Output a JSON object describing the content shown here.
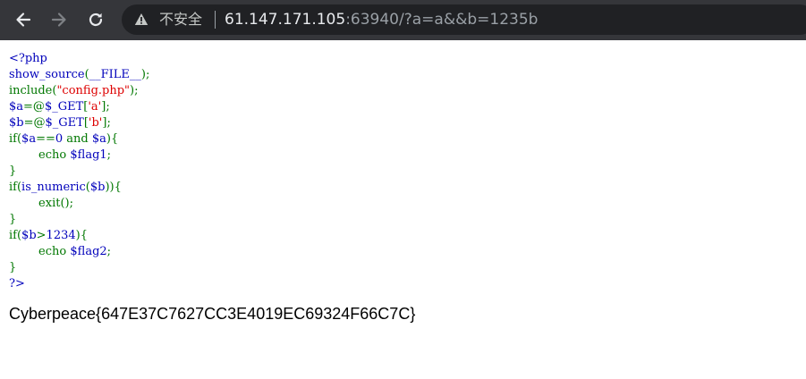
{
  "browser": {
    "security_label": "不安全",
    "url_host": "61.147.171.105",
    "url_rest": ":63940/?a=a&&b=1235b"
  },
  "icons": {
    "back": "arrow-left-icon",
    "forward": "arrow-right-icon",
    "reload": "reload-icon",
    "security": "warning-triangle-icon"
  },
  "colors": {
    "toolbar": "#35363a",
    "omnibox": "#202124",
    "php_default": "#0000bb",
    "php_keyword": "#007700",
    "php_string": "#dd0000"
  },
  "source": {
    "lines": [
      [
        {
          "t": "<?php",
          "c": "def"
        }
      ],
      [
        {
          "t": "show_source",
          "c": "def"
        },
        {
          "t": "(",
          "c": "kw"
        },
        {
          "t": "__FILE__",
          "c": "def"
        },
        {
          "t": ");",
          "c": "kw"
        }
      ],
      [
        {
          "t": "include(",
          "c": "kw"
        },
        {
          "t": "\"config.php\"",
          "c": "str"
        },
        {
          "t": ");",
          "c": "kw"
        }
      ],
      [
        {
          "t": "$a",
          "c": "def"
        },
        {
          "t": "=@",
          "c": "kw"
        },
        {
          "t": "$_GET",
          "c": "def"
        },
        {
          "t": "[",
          "c": "kw"
        },
        {
          "t": "'a'",
          "c": "str"
        },
        {
          "t": "];",
          "c": "kw"
        }
      ],
      [
        {
          "t": "$b",
          "c": "def"
        },
        {
          "t": "=@",
          "c": "kw"
        },
        {
          "t": "$_GET",
          "c": "def"
        },
        {
          "t": "[",
          "c": "kw"
        },
        {
          "t": "'b'",
          "c": "str"
        },
        {
          "t": "];",
          "c": "kw"
        }
      ],
      [
        {
          "t": "if(",
          "c": "kw"
        },
        {
          "t": "$a",
          "c": "def"
        },
        {
          "t": "==",
          "c": "kw"
        },
        {
          "t": "0 ",
          "c": "def"
        },
        {
          "t": "and ",
          "c": "kw"
        },
        {
          "t": "$a",
          "c": "def"
        },
        {
          "t": "){",
          "c": "kw"
        }
      ],
      [
        {
          "t": "        echo ",
          "c": "kw"
        },
        {
          "t": "$flag1",
          "c": "def"
        },
        {
          "t": ";",
          "c": "kw"
        }
      ],
      [
        {
          "t": "}",
          "c": "kw"
        }
      ],
      [
        {
          "t": "if(",
          "c": "kw"
        },
        {
          "t": "is_numeric",
          "c": "def"
        },
        {
          "t": "(",
          "c": "kw"
        },
        {
          "t": "$b",
          "c": "def"
        },
        {
          "t": ")){",
          "c": "kw"
        }
      ],
      [
        {
          "t": "        exit",
          "c": "kw"
        },
        {
          "t": "();",
          "c": "kw"
        }
      ],
      [
        {
          "t": "}",
          "c": "kw"
        }
      ],
      [
        {
          "t": "if(",
          "c": "kw"
        },
        {
          "t": "$b",
          "c": "def"
        },
        {
          "t": ">",
          "c": "kw"
        },
        {
          "t": "1234",
          "c": "def"
        },
        {
          "t": "){",
          "c": "kw"
        }
      ],
      [
        {
          "t": "        echo ",
          "c": "kw"
        },
        {
          "t": "$flag2",
          "c": "def"
        },
        {
          "t": ";",
          "c": "kw"
        }
      ],
      [
        {
          "t": "}",
          "c": "kw"
        }
      ],
      [
        {
          "t": "?>",
          "c": "def"
        }
      ]
    ]
  },
  "output": {
    "flag": "Cyberpeace{647E37C7627CC3E4019EC69324F66C7C}"
  }
}
